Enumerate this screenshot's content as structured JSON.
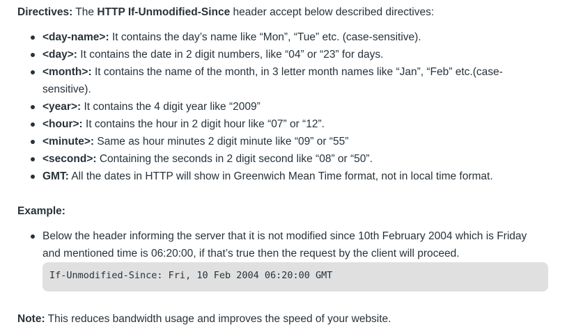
{
  "intro": {
    "label": "Directives:",
    "pre": "The",
    "header_name": "HTTP If-Unmodified-Since",
    "post": "header accept below described directives:"
  },
  "directives": [
    {
      "term": "<day-name>:",
      "text": "It contains the day’s name like “Mon”, “Tue” etc. (case-sensitive)."
    },
    {
      "term": "<day>:",
      "text": "It contains the date in 2 digit numbers, like “04” or “23” for days."
    },
    {
      "term": "<month>:",
      "text": "It contains the name of the month, in 3 letter month names like “Jan”, “Feb” etc.(case-sensitive)."
    },
    {
      "term": "<year>:",
      "text": "It contains the 4 digit year like “2009”"
    },
    {
      "term": "<hour>:",
      "text": "It contains the hour in 2 digit hour like “07” or “12”."
    },
    {
      "term": "<minute>:",
      "text": "Same as hour minutes 2 digit minute like “09” or “55”"
    },
    {
      "term": "<second>:",
      "text": "Containing the seconds in 2 digit second like “08” or “50”."
    },
    {
      "term": "GMT:",
      "text": "All the dates in HTTP will show in Greenwich Mean Time format, not in local time format."
    }
  ],
  "example": {
    "heading": "Example:",
    "item_text": "Below the header informing the server that it is not modified since 10th February 2004 which is Friday and mentioned time is 06:20:00, if that’s true then the request by the client will proceed.",
    "code": "If-Unmodified-Since: Fri, 10 Feb 2004 06:20:00 GMT"
  },
  "note": {
    "label": "Note:",
    "text": "This reduces bandwidth usage and improves the speed of your website."
  }
}
